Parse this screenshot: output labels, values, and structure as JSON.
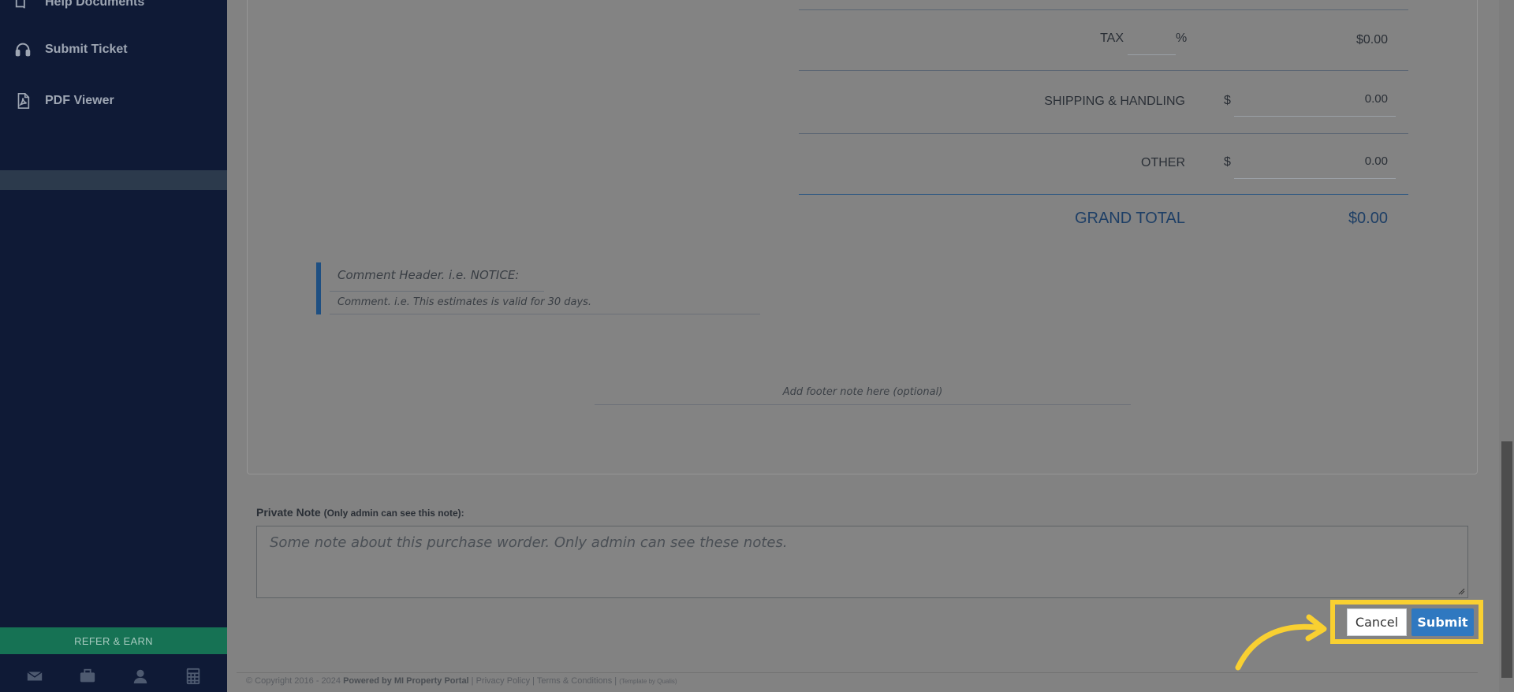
{
  "sidebar": {
    "items": [
      {
        "label": "Help Documents",
        "icon": "book-icon"
      },
      {
        "label": "Submit Ticket",
        "icon": "headset-icon"
      },
      {
        "label": "PDF Viewer",
        "icon": "pdf-icon"
      }
    ],
    "refer_label": "REFER & EARN",
    "bottom_icons": [
      "envelope-icon",
      "briefcase-icon",
      "user-icon",
      "calculator-icon"
    ]
  },
  "totals": {
    "tax_label": "TAX",
    "tax_percent_sign": "%",
    "tax_value": "$0.00",
    "shipping_label": "SHIPPING & HANDLING",
    "shipping_currency": "$",
    "shipping_value": "0.00",
    "other_label": "OTHER",
    "other_currency": "$",
    "other_value": "0.00",
    "grand_total_label": "GRAND TOTAL",
    "grand_total_value": "$0.00"
  },
  "comment": {
    "header_placeholder": "Comment Header. i.e. NOTICE:",
    "text_placeholder": "Comment. i.e. This estimates is valid for 30 days."
  },
  "footer_note_placeholder": "Add footer note here (optional)",
  "private_note": {
    "label": "Private Note",
    "sublabel": "(Only admin can see this note):",
    "placeholder": "Some note about this purchase worder. Only admin can see these notes."
  },
  "buttons": {
    "cancel": "Cancel",
    "submit": "Submit"
  },
  "footer": {
    "copyright": "© Copyright 2016 - 2024",
    "powered_by": "Powered by MI Property Portal",
    "privacy": "Privacy Policy",
    "terms": "Terms & Conditions",
    "template_by": "(Template by Qualis)"
  },
  "colors": {
    "sidebar_bg": "#0f1a36",
    "refer_bg": "#167254",
    "submit_bg": "#2f78c0",
    "highlight": "#f9d031",
    "grand_total": "#1e3f66"
  }
}
